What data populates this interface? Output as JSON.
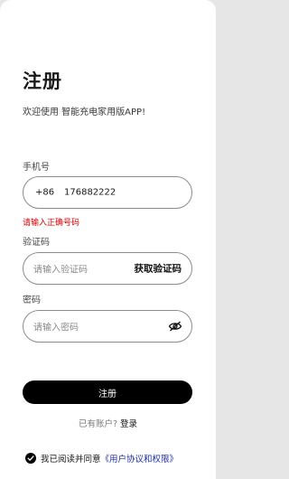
{
  "header": {
    "title": "注册",
    "subtitle": "欢迎使用 智能充电家用版APP!"
  },
  "phone": {
    "label": "手机号",
    "country_code": "+86",
    "value": "176882222",
    "error": "请输入正确号码"
  },
  "code": {
    "label": "验证码",
    "placeholder": "请输入验证码",
    "get_code_label": "获取验证码"
  },
  "password": {
    "label": "密码",
    "placeholder": "请输入密码",
    "toggle_icon": "eye-slash-icon"
  },
  "actions": {
    "register_label": "注册",
    "login_prompt": "已有账户?",
    "login_link": "登录"
  },
  "agreement": {
    "checked": true,
    "text": "我已阅读并同意",
    "link": "《用户协议和权限》"
  },
  "colors": {
    "error": "#d90000",
    "link": "#1f2fa8",
    "button": "#000000"
  }
}
